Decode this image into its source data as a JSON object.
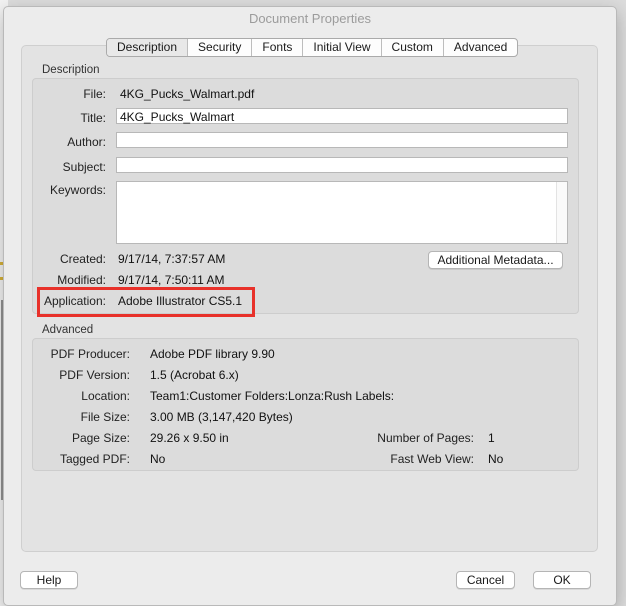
{
  "window": {
    "title": "Document Properties"
  },
  "tabs": [
    {
      "label": "Description",
      "active": true
    },
    {
      "label": "Security",
      "active": false
    },
    {
      "label": "Fonts",
      "active": false
    },
    {
      "label": "Initial View",
      "active": false
    },
    {
      "label": "Custom",
      "active": false
    },
    {
      "label": "Advanced",
      "active": false
    }
  ],
  "description": {
    "section_label": "Description",
    "file_label": "File:",
    "file_value": "4KG_Pucks_Walmart.pdf",
    "title_label": "Title:",
    "title_value": "4KG_Pucks_Walmart",
    "author_label": "Author:",
    "author_value": "",
    "subject_label": "Subject:",
    "subject_value": "",
    "keywords_label": "Keywords:",
    "keywords_value": "",
    "created_label": "Created:",
    "created_value": "9/17/14, 7:37:57 AM",
    "modified_label": "Modified:",
    "modified_value": "9/17/14, 7:50:11 AM",
    "application_label": "Application:",
    "application_value": "Adobe Illustrator CS5.1",
    "additional_metadata_label": "Additional Metadata..."
  },
  "advanced": {
    "section_label": "Advanced",
    "producer_label": "PDF Producer:",
    "producer_value": "Adobe PDF library 9.90",
    "version_label": "PDF Version:",
    "version_value": "1.5 (Acrobat 6.x)",
    "location_label": "Location:",
    "location_value": "Team1:Customer Folders:Lonza:Rush Labels:",
    "filesize_label": "File Size:",
    "filesize_value": "3.00 MB (3,147,420 Bytes)",
    "pagesize_label": "Page Size:",
    "pagesize_value": "29.26 x 9.50 in",
    "numpages_label": "Number of Pages:",
    "numpages_value": "1",
    "tagged_label": "Tagged PDF:",
    "tagged_value": "No",
    "fastweb_label": "Fast Web View:",
    "fastweb_value": "No"
  },
  "footer": {
    "help_label": "Help",
    "cancel_label": "Cancel",
    "ok_label": "OK"
  },
  "colors": {
    "highlight": "#e8312a"
  }
}
